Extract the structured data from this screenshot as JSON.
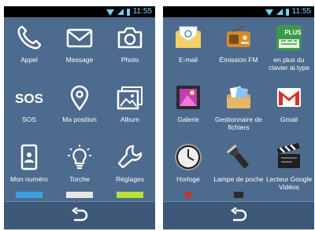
{
  "status_bar": {
    "time": "11:55"
  },
  "left_screen": {
    "apps": [
      {
        "label": "Appel",
        "icon": "phone-icon"
      },
      {
        "label": "Message",
        "icon": "envelope-icon"
      },
      {
        "label": "Photo",
        "icon": "camera-icon"
      },
      {
        "label": "SOS",
        "icon": "sos-icon",
        "icon_text": "SOS"
      },
      {
        "label": "Ma position",
        "icon": "location-pin-icon"
      },
      {
        "label": "Album",
        "icon": "gallery-icon"
      },
      {
        "label": "Mon numéro",
        "icon": "contact-card-icon"
      },
      {
        "label": "Torche",
        "icon": "lightbulb-icon"
      },
      {
        "label": "Réglages",
        "icon": "wrench-icon"
      }
    ]
  },
  "right_screen": {
    "apps": [
      {
        "label": "E-mail",
        "icon": "email-icon"
      },
      {
        "label": "Émission FM",
        "icon": "radio-icon"
      },
      {
        "label": "en plus du clavier ai.type",
        "icon": "aitype-plus-icon",
        "icon_text": "PLUS"
      },
      {
        "label": "Galerie",
        "icon": "galerie-icon"
      },
      {
        "label": "Gestionnaire de fichiers",
        "icon": "file-manager-icon"
      },
      {
        "label": "Gmail",
        "icon": "gmail-icon"
      },
      {
        "label": "Horloge",
        "icon": "clock-icon"
      },
      {
        "label": "Lampe de poche",
        "icon": "flashlight-icon"
      },
      {
        "label": "Lecteur Google Vidéos",
        "icon": "clapperboard-icon"
      }
    ]
  },
  "colors": {
    "background": "#4d6b8e",
    "bottom_bar": "#3d5878",
    "status_bar": "#000000",
    "status_accent": "#6fd3ff"
  }
}
